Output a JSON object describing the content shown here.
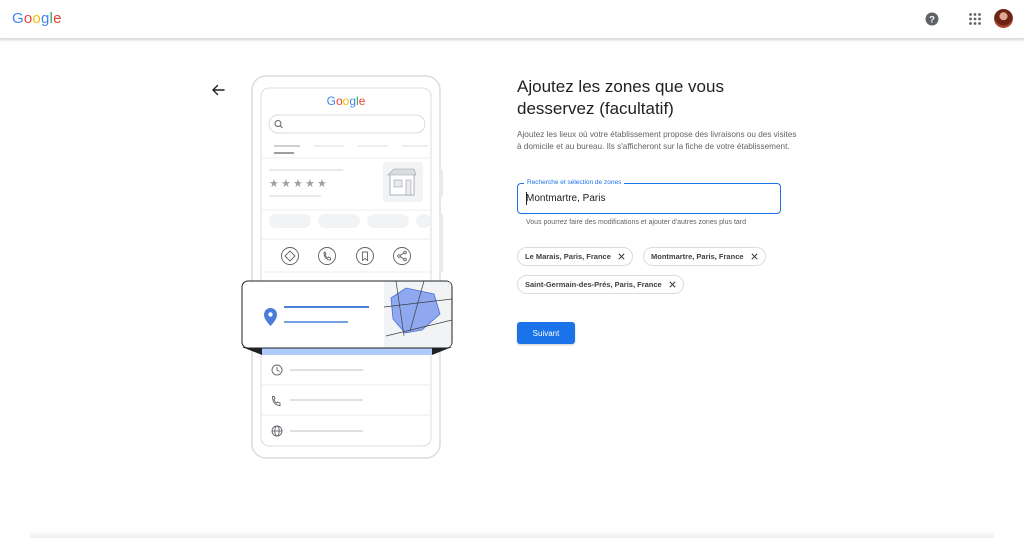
{
  "header": {
    "logo": {
      "letters": [
        {
          "ch": "G",
          "color": "#4285F4"
        },
        {
          "ch": "o",
          "color": "#EA4335"
        },
        {
          "ch": "o",
          "color": "#FBBC05"
        },
        {
          "ch": "g",
          "color": "#4285F4"
        },
        {
          "ch": "l",
          "color": "#34A853"
        },
        {
          "ch": "e",
          "color": "#EA4335"
        }
      ]
    },
    "help_icon": "help-circle-icon",
    "apps_icon": "apps-grid-icon"
  },
  "illustration": {
    "phone_logo": "Google",
    "rating_stars": 5
  },
  "main": {
    "title": "Ajoutez les zones que vous desservez (facultatif)",
    "description": "Ajoutez les lieux où votre établissement propose des livraisons ou des visites à domicile et au bureau. Ils s'afficheront sur la fiche de votre établissement.",
    "search": {
      "label": "Recherche et sélection de zones",
      "value": "Montmartre, Paris"
    },
    "helper_text": "Vous pourrez faire des modifications et ajouter d'autres zones plus tard",
    "chips": [
      {
        "label": "Le Marais, Paris, France"
      },
      {
        "label": "Montmartre, Paris, France"
      },
      {
        "label": "Saint-Germain-des-Prés, Paris, France"
      }
    ],
    "next_label": "Suivant"
  },
  "colors": {
    "accent": "#1a73e8",
    "map_fill": "#8fa8f0",
    "pin": "#4a7ed8"
  }
}
